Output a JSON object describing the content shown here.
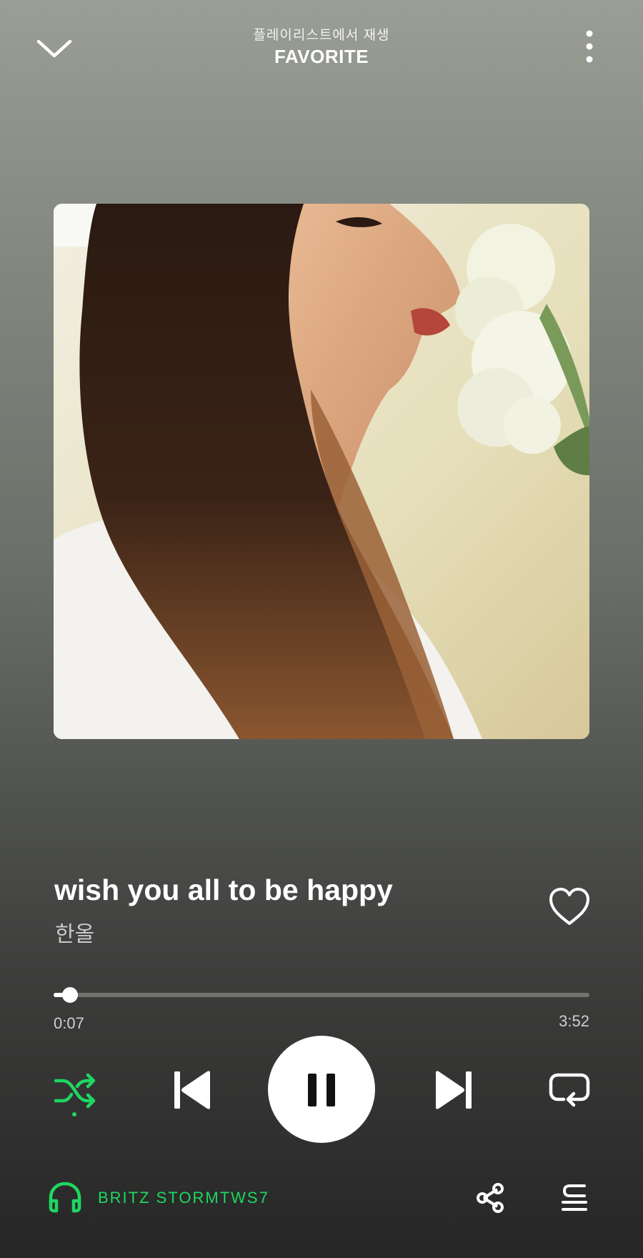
{
  "header": {
    "context_label": "플레이리스트에서 재생",
    "playlist_name": "FAVORITE"
  },
  "track": {
    "title": "wish you all to be happy",
    "artist": "한올",
    "liked": false
  },
  "progress": {
    "elapsed": "0:07",
    "total": "3:52",
    "fraction": 0.03
  },
  "controls": {
    "shuffle_active": true,
    "is_playing": true,
    "repeat_active": false
  },
  "device": {
    "name": "BRITZ STORMTWS7"
  },
  "colors": {
    "accent": "#1ed760",
    "background_top": "#9a9e95",
    "background_bottom": "#262626"
  },
  "icons": {
    "collapse": "chevron-down-icon",
    "more": "more-vertical-icon",
    "like": "heart-outline-icon",
    "shuffle": "shuffle-icon",
    "previous": "skip-previous-icon",
    "play_pause": "pause-icon",
    "next": "skip-next-icon",
    "repeat": "repeat-icon",
    "device": "headphones-icon",
    "share": "share-icon",
    "queue": "queue-icon"
  }
}
